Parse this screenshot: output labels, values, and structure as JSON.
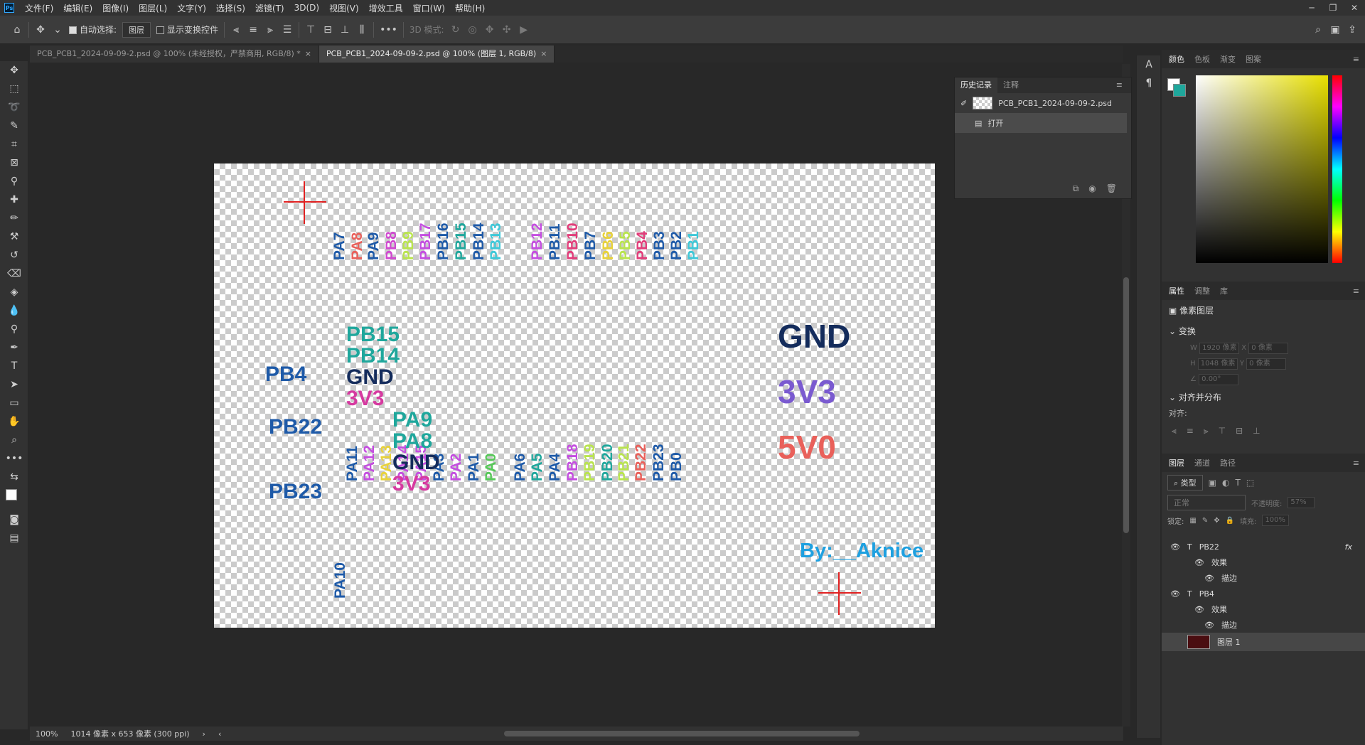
{
  "app": {
    "logo": "Ps"
  },
  "menubar": [
    "文件(F)",
    "编辑(E)",
    "图像(I)",
    "图层(L)",
    "文字(Y)",
    "选择(S)",
    "滤镜(T)",
    "3D(D)",
    "视图(V)",
    "增效工具",
    "窗口(W)",
    "帮助(H)"
  ],
  "options": {
    "auto_select_label": "自动选择:",
    "auto_select_value": "图层",
    "show_transform_label": "显示变换控件",
    "mode_3d_label": "3D 模式:"
  },
  "tabs": [
    {
      "label": "PCB_PCB1_2024-09-09-2.psd @ 100% (未经授权，严禁商用, RGB/8) *",
      "active": false
    },
    {
      "label": "PCB_PCB1_2024-09-09-2.psd @ 100% (图层 1, RGB/8)",
      "active": true
    }
  ],
  "canvas": {
    "top_pins": [
      {
        "text": "PA7",
        "color": "#1e5aa8"
      },
      {
        "text": "PA8",
        "color": "#e9605a"
      },
      {
        "text": "PA9",
        "color": "#1e5aa8"
      },
      {
        "text": "PB8",
        "color": "#d04ad0"
      },
      {
        "text": "PB9",
        "color": "#b9e44e"
      },
      {
        "text": "PB17",
        "color": "#c44ee0"
      },
      {
        "text": "PB16",
        "color": "#1e5aa8"
      },
      {
        "text": "PB15",
        "color": "#1fa79c"
      },
      {
        "text": "PB14",
        "color": "#1e5aa8"
      },
      {
        "text": "PB13",
        "color": "#3ec8d8"
      },
      {
        "text": "PB12",
        "color": "#c44ee0"
      },
      {
        "text": "PB11",
        "color": "#1e5aa8"
      },
      {
        "text": "PB10",
        "color": "#e23d7a"
      },
      {
        "text": "PB7",
        "color": "#1e5aa8"
      },
      {
        "text": "PB6",
        "color": "#e8d23a"
      },
      {
        "text": "PB5",
        "color": "#b9e44e"
      },
      {
        "text": "PB4",
        "color": "#e23d7a"
      },
      {
        "text": "PB3",
        "color": "#1e5aa8"
      },
      {
        "text": "PB2",
        "color": "#1e5aa8"
      },
      {
        "text": "PB1",
        "color": "#3ec8d8"
      }
    ],
    "bottom_pins": [
      {
        "text": "PA11",
        "color": "#1e5aa8"
      },
      {
        "text": "PA12",
        "color": "#c44ee0"
      },
      {
        "text": "PA13",
        "color": "#e8d23a"
      },
      {
        "text": "PA14",
        "color": "#c44ee0"
      },
      {
        "text": "PA15",
        "color": "#c44ee0"
      },
      {
        "text": "PA3",
        "color": "#1e5aa8"
      },
      {
        "text": "PA2",
        "color": "#c44ee0"
      },
      {
        "text": "PA1",
        "color": "#1e5aa8"
      },
      {
        "text": "PA0",
        "color": "#58c85a"
      },
      {
        "text": "PA6",
        "color": "#1e5aa8"
      },
      {
        "text": "PA5",
        "color": "#1fa79c"
      },
      {
        "text": "PA4",
        "color": "#1e5aa8"
      },
      {
        "text": "PB18",
        "color": "#c44ee0"
      },
      {
        "text": "PB19",
        "color": "#b9e44e"
      },
      {
        "text": "PB20",
        "color": "#1fa79c"
      },
      {
        "text": "PB21",
        "color": "#b9e44e"
      },
      {
        "text": "PB22",
        "color": "#e9605a"
      },
      {
        "text": "PB23",
        "color": "#1e5aa8"
      },
      {
        "text": "PB0",
        "color": "#1e5aa8"
      }
    ],
    "pin_pa10": {
      "text": "PA10",
      "color": "#1e5aa8"
    },
    "left_labels": [
      {
        "text": "PB15",
        "color": "#1fa79c"
      },
      {
        "text": "PB14",
        "color": "#1fa79c"
      },
      {
        "text": "GND",
        "color": "#142c5c"
      },
      {
        "text": "3V3",
        "color": "#d63aa0"
      },
      {
        "text": "PA9",
        "color": "#1fa79c"
      },
      {
        "text": "PA8",
        "color": "#1fa79c"
      },
      {
        "text": "GND",
        "color": "#142c5c"
      },
      {
        "text": "3V3",
        "color": "#d63aa0"
      },
      {
        "text": "PB4",
        "color": "#1e5aa8"
      },
      {
        "text": "PB22",
        "color": "#1e5aa8"
      },
      {
        "text": "PB23",
        "color": "#1e5aa8"
      }
    ],
    "power_labels": [
      {
        "text": "GND",
        "color": "#142c5c"
      },
      {
        "text": "3V3",
        "color": "#7a5ad0"
      },
      {
        "text": "5V0",
        "color": "#e9605a"
      }
    ],
    "author": {
      "text": "By:__Aknice",
      "color": "#1ea0e0"
    }
  },
  "status": {
    "zoom": "100%",
    "doc_info": "1014 像素 x 653 像素 (300 ppi)"
  },
  "history": {
    "tabs": [
      "历史记录",
      "注释"
    ],
    "snapshot": "PCB_PCB1_2024-09-09-2.psd",
    "step": "打开"
  },
  "color_panel": {
    "tabs": [
      "颜色",
      "色板",
      "渐变",
      "图案"
    ]
  },
  "properties": {
    "tabs": [
      "属性",
      "调整",
      "库"
    ],
    "kind": "像素图层",
    "transform_title": "变换",
    "w": "1920 像素",
    "h": "1048 像素",
    "x": "0 像素",
    "y": "0 像素",
    "angle": "0.00°",
    "align_title": "对齐并分布",
    "align_label": "对齐:"
  },
  "layers": {
    "tabs": [
      "图层",
      "通道",
      "路径"
    ],
    "filter": "类型",
    "blend": "正常",
    "opacity_label": "不透明度:",
    "opacity": "57%",
    "lock_label": "锁定:",
    "fill_label": "填充:",
    "fill": "100%",
    "items": [
      {
        "name": "PB22",
        "type": "T",
        "effects": "效果",
        "stroke": "描边"
      },
      {
        "name": "PB4",
        "type": "T",
        "effects": "效果",
        "stroke": "描边"
      },
      {
        "name": "图层 1",
        "type": "img"
      }
    ]
  }
}
